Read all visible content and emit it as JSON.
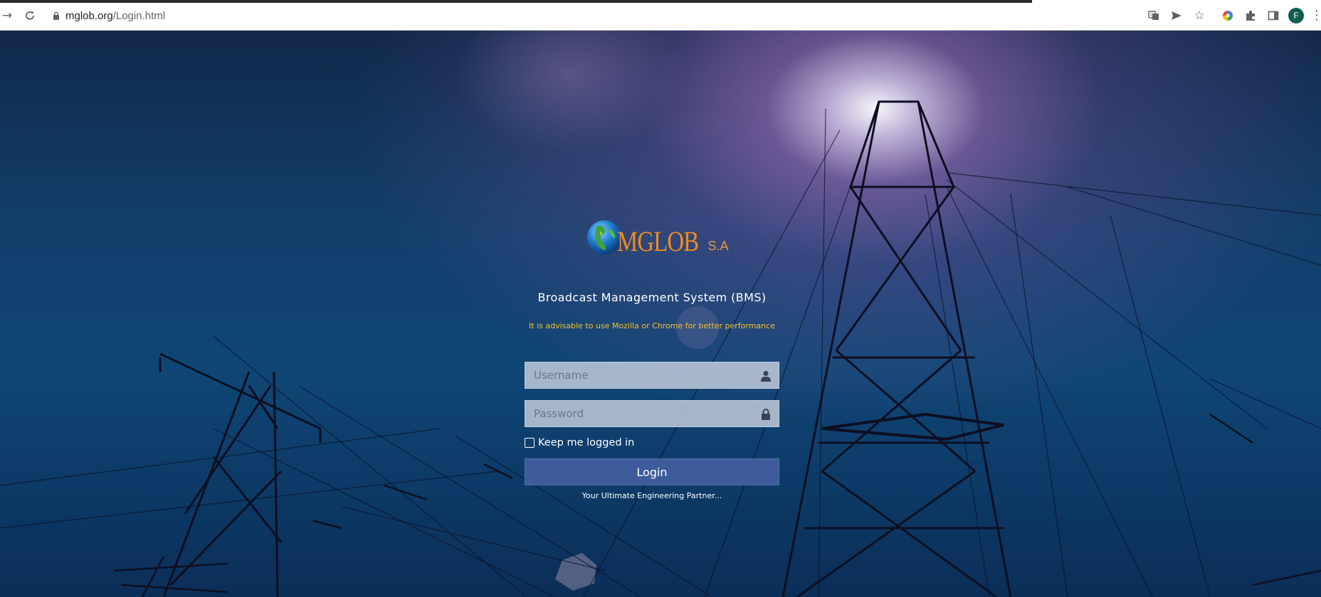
{
  "browser": {
    "url_domain": "mglob.org",
    "url_path": "/Login.html",
    "profile_initial": "F",
    "icons": [
      "forward-icon",
      "reload-icon",
      "lock-icon",
      "translate-icon",
      "send-icon",
      "star-icon",
      "color-wheel-icon",
      "extensions-icon",
      "side-panel-icon",
      "menu-icon"
    ]
  },
  "login": {
    "logo_text": "MGLOB",
    "logo_suffix": "S.A",
    "title": "Broadcast Management System (BMS)",
    "notice": "It is advisable to use Mozilla or Chrome for better performance",
    "username_placeholder": "Username",
    "password_placeholder": "Password",
    "username_value": "",
    "password_value": "",
    "keep_logged_in_label": "Keep me logged in",
    "keep_logged_in_checked": false,
    "login_button": "Login",
    "tagline": "Your Ultimate Engineering Partner..."
  },
  "colors": {
    "notice": "#f5c02a",
    "button": "#3e5b9a",
    "logo": "#f08b1f"
  }
}
